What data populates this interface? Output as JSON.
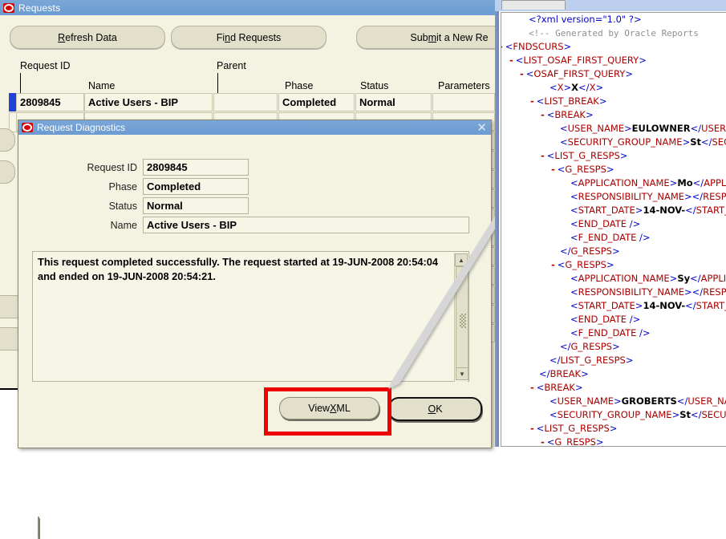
{
  "requests_window": {
    "title": "Requests",
    "logo_icon": "oracle-logo-icon",
    "toolbar": {
      "refresh_label_a": "R",
      "refresh_label_b": "efresh Data",
      "find_label_a": "Fi",
      "find_label_b": "n",
      "find_label_c": "d Requests",
      "submit_label_a": "Sub",
      "submit_label_b": "m",
      "submit_label_c": "it a New Re"
    },
    "headers": {
      "request_id": "Request ID",
      "parent": "Parent",
      "name": "Name",
      "phase": "Phase",
      "status": "Status",
      "parameters": "Parameters"
    },
    "rows": [
      {
        "request_id": "2809845",
        "name": "Active Users - BIP",
        "parent": "",
        "phase": "Completed",
        "status": "Normal",
        "parameters": ""
      }
    ]
  },
  "dialog": {
    "title": "Request Diagnostics",
    "logo_icon": "oracle-logo-icon",
    "close_icon": "close-icon",
    "fields": {
      "request_id_label": "Request ID",
      "request_id_value": "2809845",
      "phase_label": "Phase",
      "phase_value": "Completed",
      "status_label": "Status",
      "status_value": "Normal",
      "name_label": "Name",
      "name_value": "Active Users - BIP"
    },
    "message": "This request completed successfully. The request started at 19-JUN-2008 20:54:04 and ended on 19-JUN-2008 20:54:21.",
    "scrollbar": {
      "up_icon": "caret-up-icon",
      "down_icon": "caret-down-icon"
    },
    "buttons": {
      "view_xml_a": "View ",
      "view_xml_b": "X",
      "view_xml_c": "ML",
      "ok_a": "O",
      "ok_b": "K"
    },
    "highlight_color": "#ee0000"
  },
  "annotation": {
    "arrow_name": "callout-arrow",
    "arrow_color": "#d4d4d4"
  },
  "xml_viewer": {
    "lines": [
      {
        "indent": 2,
        "marker": "",
        "type": "pi",
        "text": "<?xml version=\"1.0\" ?>"
      },
      {
        "indent": 2,
        "marker": "",
        "type": "comment",
        "text": "<!--  Generated by Oracle Reports"
      },
      {
        "indent": 0,
        "marker": "-",
        "type": "open",
        "tag": "FNDSCURS"
      },
      {
        "indent": 1,
        "marker": "-",
        "type": "open",
        "tag": "LIST_OSAF_FIRST_QUERY"
      },
      {
        "indent": 2,
        "marker": "-",
        "type": "open",
        "tag": "OSAF_FIRST_QUERY"
      },
      {
        "indent": 4,
        "marker": "",
        "type": "pair",
        "tag": "X",
        "value": "X"
      },
      {
        "indent": 3,
        "marker": "-",
        "type": "open",
        "tag": "LIST_BREAK"
      },
      {
        "indent": 4,
        "marker": "-",
        "type": "open",
        "tag": "BREAK"
      },
      {
        "indent": 5,
        "marker": "",
        "type": "pair",
        "tag": "USER_NAME",
        "value": "EULOWNER"
      },
      {
        "indent": 5,
        "marker": "",
        "type": "pair",
        "tag": "SECURITY_GROUP_NAME",
        "value": "St"
      },
      {
        "indent": 4,
        "marker": "-",
        "type": "open",
        "tag": "LIST_G_RESPS"
      },
      {
        "indent": 5,
        "marker": "-",
        "type": "open",
        "tag": "G_RESPS"
      },
      {
        "indent": 6,
        "marker": "",
        "type": "pair",
        "tag": "APPLICATION_NAME",
        "value": "Mo"
      },
      {
        "indent": 6,
        "marker": "",
        "type": "pair",
        "tag": "RESPONSIBILITY_NAME",
        "value": ""
      },
      {
        "indent": 6,
        "marker": "",
        "type": "pair",
        "tag": "START_DATE",
        "value": "14-NOV-"
      },
      {
        "indent": 6,
        "marker": "",
        "type": "empty",
        "tag": "END_DATE"
      },
      {
        "indent": 6,
        "marker": "",
        "type": "empty",
        "tag": "F_END_DATE"
      },
      {
        "indent": 5,
        "marker": "",
        "type": "close",
        "tag": "G_RESPS"
      },
      {
        "indent": 5,
        "marker": "-",
        "type": "open",
        "tag": "G_RESPS"
      },
      {
        "indent": 6,
        "marker": "",
        "type": "pair",
        "tag": "APPLICATION_NAME",
        "value": "Sy"
      },
      {
        "indent": 6,
        "marker": "",
        "type": "pair",
        "tag": "RESPONSIBILITY_NAME",
        "value": ""
      },
      {
        "indent": 6,
        "marker": "",
        "type": "pair",
        "tag": "START_DATE",
        "value": "14-NOV-"
      },
      {
        "indent": 6,
        "marker": "",
        "type": "empty",
        "tag": "END_DATE"
      },
      {
        "indent": 6,
        "marker": "",
        "type": "empty",
        "tag": "F_END_DATE"
      },
      {
        "indent": 5,
        "marker": "",
        "type": "close",
        "tag": "G_RESPS"
      },
      {
        "indent": 4,
        "marker": "",
        "type": "close",
        "tag": "LIST_G_RESPS"
      },
      {
        "indent": 3,
        "marker": "",
        "type": "close",
        "tag": "BREAK"
      },
      {
        "indent": 3,
        "marker": "-",
        "type": "open",
        "tag": "BREAK"
      },
      {
        "indent": 4,
        "marker": "",
        "type": "pair",
        "tag": "USER_NAME",
        "value": "GROBERTS"
      },
      {
        "indent": 4,
        "marker": "",
        "type": "pair",
        "tag": "SECURITY_GROUP_NAME",
        "value": "St"
      },
      {
        "indent": 3,
        "marker": "-",
        "type": "open",
        "tag": "LIST_G_RESPS"
      },
      {
        "indent": 4,
        "marker": "-",
        "type": "open",
        "tag": "G_RESPS"
      }
    ]
  }
}
